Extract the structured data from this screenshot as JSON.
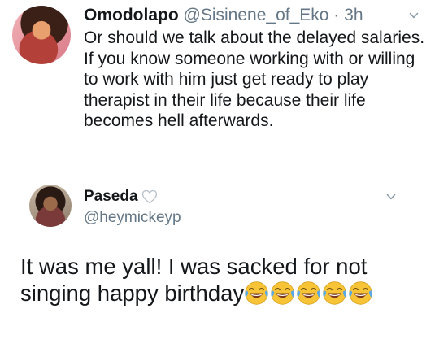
{
  "tweet1": {
    "name": "Omodolapo",
    "handle": "@Sisinene_of_Eko",
    "separator": "·",
    "time": "3h",
    "paragraph1": "Or should we talk about the delayed salaries.",
    "paragraph2": "If you know someone working with or willing to work with him just get ready to play therapist in their life because their life becomes hell afterwards.",
    "avatar_icon": "profile-photo",
    "menu_icon": "chevron-down-icon"
  },
  "tweet2": {
    "name": "Paseda",
    "name_badge_icon": "white-heart-icon",
    "handle": "@heymickeyp",
    "text": "It was me yall! I was sacked for not singing happy birthday",
    "emoji_icon": "face-with-tears-of-joy",
    "emoji_count": 5,
    "menu_icon": "chevron-down-icon"
  },
  "colors": {
    "text": "#14171a",
    "muted": "#657786",
    "emoji_face": "#f7c437",
    "emoji_tears": "#5aa9e6"
  }
}
